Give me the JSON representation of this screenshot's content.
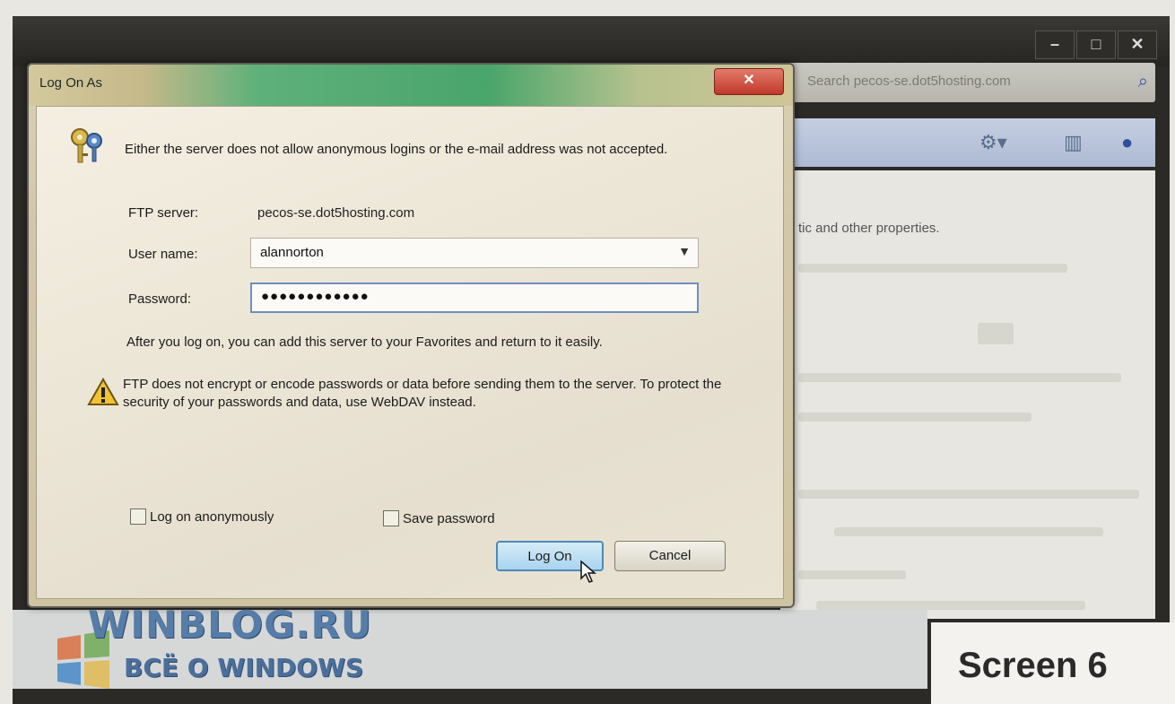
{
  "outer_window": {
    "controls": [
      "–",
      "□",
      "✕"
    ],
    "address_text": "Search pecos-se.dot5hosting.com",
    "content_line": "tic and other properties.",
    "icons": [
      "settings-icon",
      "pane-icon",
      "help-icon",
      "search-icon"
    ]
  },
  "dialog": {
    "title": "Log On As",
    "close_label": "✕",
    "message": "Either the server does not allow anonymous logins or the e-mail address was not accepted.",
    "ftp_server_label": "FTP server:",
    "ftp_server_value": "pecos-se.dot5hosting.com",
    "username_label": "User name:",
    "username_value": "alannorton",
    "password_label": "Password:",
    "password_value": "●●●●●●●●●●●●",
    "info_text": "After you log on, you can add this server to your Favorites and return to it easily.",
    "warning_text": "FTP does not encrypt or encode passwords or data before sending them to the server.  To protect the security of your passwords and data, use WebDAV instead.",
    "anon_label": "Log on anonymously",
    "anon_checked": false,
    "save_pwd_label": "Save password",
    "save_pwd_checked": false,
    "logon_label": "Log On",
    "cancel_label": "Cancel"
  },
  "watermark": {
    "main": "WINBLOG.RU",
    "sub": "ВСЁ О WINDOWS"
  },
  "caption": "Screen 6"
}
